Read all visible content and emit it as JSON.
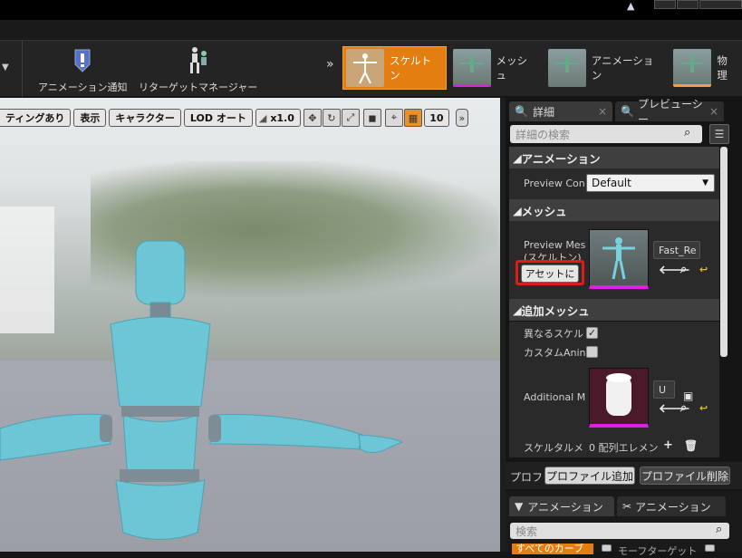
{
  "toolbar": {
    "anim_notify_label": "アニメーション通知",
    "retarget_label": "リターゲットマネージャー",
    "modes": [
      {
        "label": "スケルトン",
        "active": true
      },
      {
        "label": "メッシュ",
        "active": false
      },
      {
        "label": "アニメーション",
        "active": false
      },
      {
        "label": "物理",
        "active": false
      }
    ]
  },
  "viewport": {
    "lighting_label": "ティングあり",
    "show_label": "表示",
    "character_label": "キャラクター",
    "lod_label": "LOD オート",
    "speed_label": "x1.0",
    "grid_value": "10"
  },
  "details": {
    "tab_details": "詳細",
    "tab_preview": "プレビューシー",
    "search_placeholder": "詳細の検索",
    "section_animation": "アニメーション",
    "preview_controller_label": "Preview Con",
    "preview_controller_value": "Default",
    "section_mesh": "メッシュ",
    "preview_mesh_label_1": "Preview Mes",
    "preview_mesh_label_2": "(スケルトン)",
    "apply_asset_button": "アセットに",
    "mesh_asset_name": "Fast_Re",
    "section_additional": "追加メッシュ",
    "different_skeleton_label": "異なるスケル",
    "custom_anim_label": "カスタムAnin",
    "additional_mesh_label": "Additional M",
    "additional_mesh_value": "U",
    "skeletal_mesh_label": "スケルタルメ",
    "array_elements": "0 配列エレメン",
    "profile_label": "プロファ",
    "add_profile_button": "プロファイル追加",
    "remove_profile_button": "プロファイル削除"
  },
  "bottom_panel": {
    "tab_anim": "アニメーション",
    "tab_anim2": "アニメーション",
    "search_placeholder": "検索",
    "filter_all": "すべてのカーブ",
    "filter_morph": "モーフターゲット"
  }
}
